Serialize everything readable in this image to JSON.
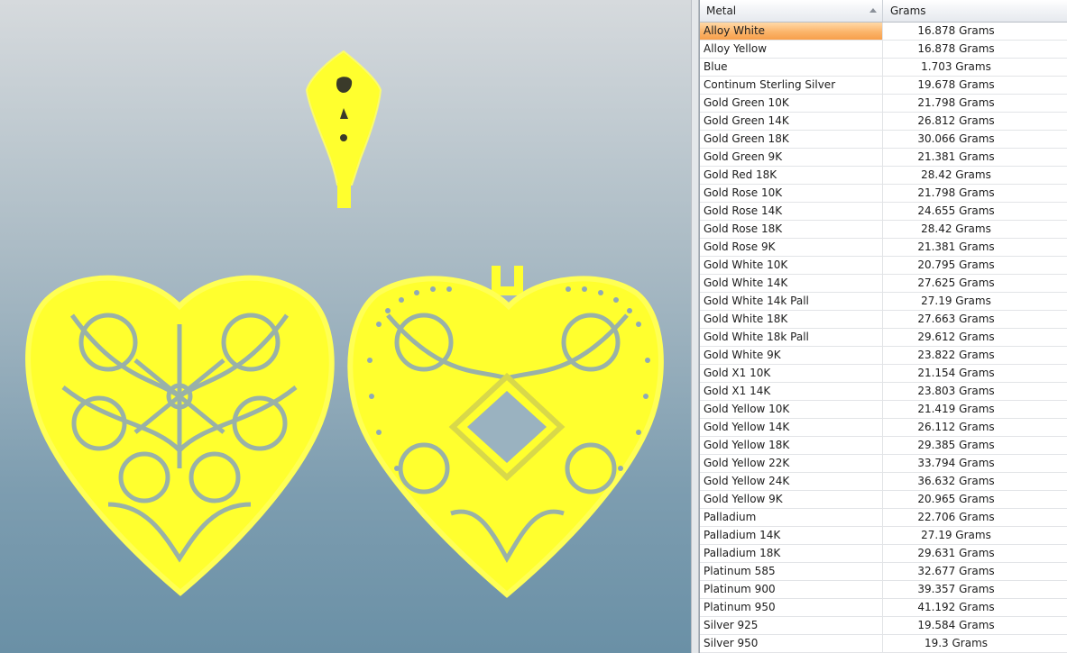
{
  "viewport": {
    "object_color": "#ffff33",
    "description_icon": "heart-locket-3d-model"
  },
  "grid": {
    "headers": {
      "metal": "Metal",
      "grams": "Grams"
    },
    "sort_icon": "sort-ascending-icon",
    "selected_index": 0,
    "selected_color": "#f9a95a",
    "rows": [
      {
        "metal": "Alloy White",
        "grams": "16.878 Grams"
      },
      {
        "metal": "Alloy Yellow",
        "grams": "16.878 Grams"
      },
      {
        "metal": "Blue",
        "grams": "1.703 Grams"
      },
      {
        "metal": "Continum Sterling Silver",
        "grams": "19.678 Grams"
      },
      {
        "metal": "Gold Green 10K",
        "grams": "21.798 Grams"
      },
      {
        "metal": "Gold Green 14K",
        "grams": "26.812 Grams"
      },
      {
        "metal": "Gold Green 18K",
        "grams": "30.066 Grams"
      },
      {
        "metal": "Gold Green 9K",
        "grams": "21.381 Grams"
      },
      {
        "metal": "Gold Red 18K",
        "grams": "28.42 Grams"
      },
      {
        "metal": "Gold Rose 10K",
        "grams": "21.798 Grams"
      },
      {
        "metal": "Gold Rose 14K",
        "grams": "24.655 Grams"
      },
      {
        "metal": "Gold Rose 18K",
        "grams": "28.42 Grams"
      },
      {
        "metal": "Gold Rose 9K",
        "grams": "21.381 Grams"
      },
      {
        "metal": "Gold White 10K",
        "grams": "20.795 Grams"
      },
      {
        "metal": "Gold White 14K",
        "grams": "27.625 Grams"
      },
      {
        "metal": "Gold White 14k Pall",
        "grams": "27.19 Grams"
      },
      {
        "metal": "Gold White 18K",
        "grams": "27.663 Grams"
      },
      {
        "metal": "Gold White 18k Pall",
        "grams": "29.612 Grams"
      },
      {
        "metal": "Gold White 9K",
        "grams": "23.822 Grams"
      },
      {
        "metal": "Gold X1 10K",
        "grams": "21.154 Grams"
      },
      {
        "metal": "Gold X1 14K",
        "grams": "23.803 Grams"
      },
      {
        "metal": "Gold Yellow 10K",
        "grams": "21.419 Grams"
      },
      {
        "metal": "Gold Yellow 14K",
        "grams": "26.112 Grams"
      },
      {
        "metal": "Gold Yellow 18K",
        "grams": "29.385 Grams"
      },
      {
        "metal": "Gold Yellow 22K",
        "grams": "33.794 Grams"
      },
      {
        "metal": "Gold Yellow 24K",
        "grams": "36.632 Grams"
      },
      {
        "metal": "Gold Yellow 9K",
        "grams": "20.965 Grams"
      },
      {
        "metal": "Palladium",
        "grams": "22.706 Grams"
      },
      {
        "metal": "Palladium 14K",
        "grams": "27.19 Grams"
      },
      {
        "metal": "Palladium 18K",
        "grams": "29.631 Grams"
      },
      {
        "metal": "Platinum 585",
        "grams": "32.677 Grams"
      },
      {
        "metal": "Platinum 900",
        "grams": "39.357 Grams"
      },
      {
        "metal": "Platinum 950",
        "grams": "41.192 Grams"
      },
      {
        "metal": "Silver 925",
        "grams": "19.584 Grams"
      },
      {
        "metal": "Silver 950",
        "grams": "19.3 Grams"
      }
    ]
  }
}
